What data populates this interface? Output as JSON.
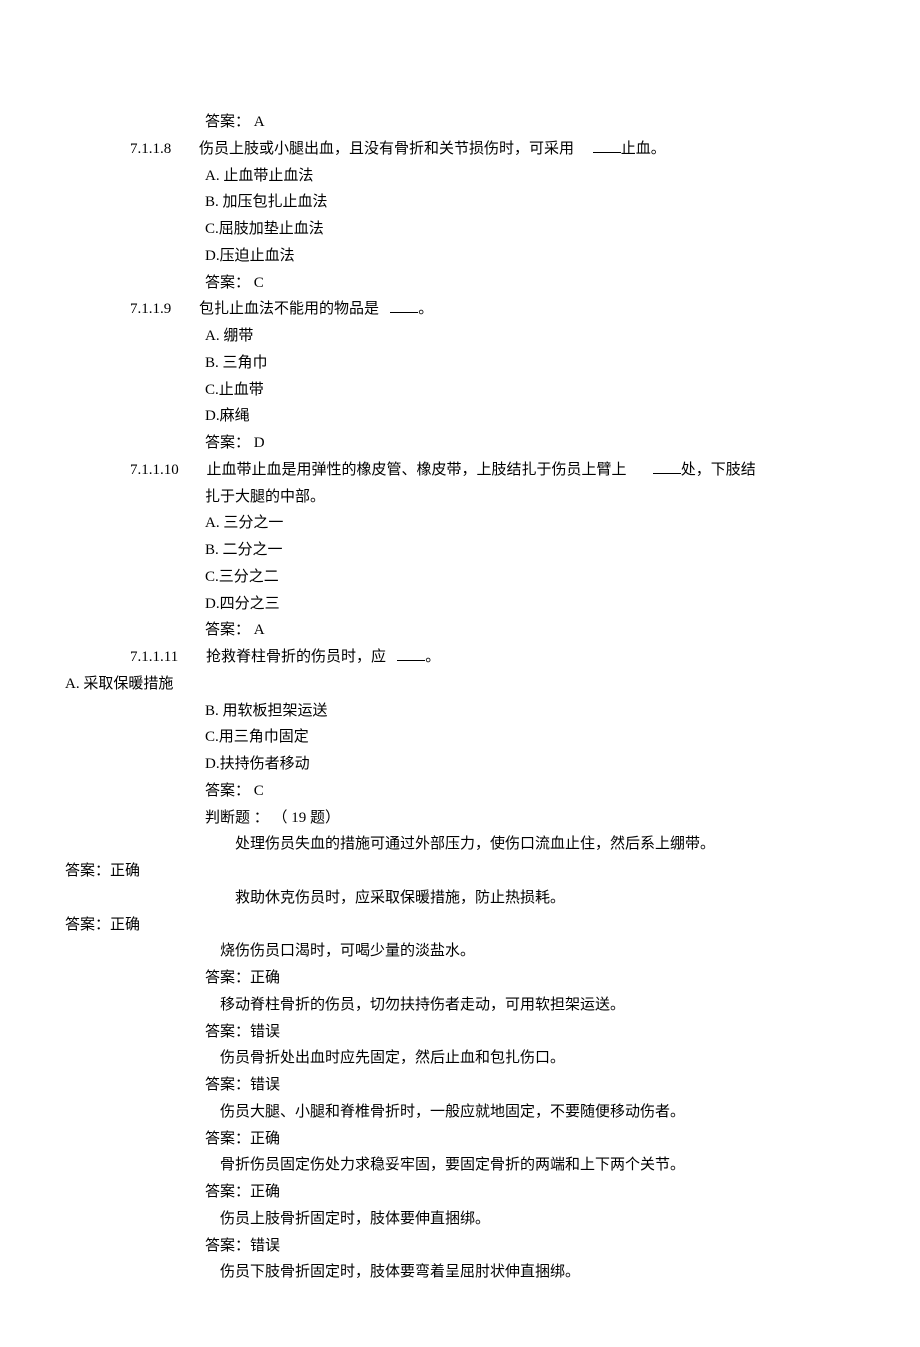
{
  "pre_answer": "答案： A",
  "q8": {
    "num": "7.1.1.8",
    "stem1": "伤员上肢或小腿出血，且没有骨折和关节损伤时，可采用",
    "stem2": "止血。",
    "A": "A. 止血带止血法",
    "B": "B. 加压包扎止血法",
    "C": "C.屈肢加垫止血法",
    "D": "D.压迫止血法",
    "ans": "答案： C"
  },
  "q9": {
    "num": "7.1.1.9",
    "stem1": "包扎止血法不能用的物品是",
    "stem2": "。",
    "A": "A. 绷带",
    "B": "B. 三角巾",
    "C": "C.止血带",
    "D": "D.麻绳",
    "ans": "答案： D"
  },
  "q10": {
    "num": "7.1.1.10",
    "stem1": "止血带止血是用弹性的橡皮管、橡皮带，上肢结扎于伤员上臂上",
    "stem2": "处，下肢结",
    "cont": "扎于大腿的中部。",
    "A": "A. 三分之一",
    "B": "B. 二分之一",
    "C": "C.三分之二",
    "D": "D.四分之三",
    "ans": "答案： A"
  },
  "q11": {
    "num": "7.1.1.11",
    "stem1": "抢救脊柱骨折的伤员时，应",
    "stem2": "。",
    "A": "A.  采取保暖措施",
    "B": "B. 用软板担架运送",
    "C": "C.用三角巾固定",
    "D": "D.扶持伤者移动",
    "ans": "答案： C"
  },
  "tf_header": "判断题 ： （ 19 题）",
  "tf": {
    "t1": {
      "q": "处理伤员失血的措施可通过外部压力，使伤口流血止住，然后系上绷带。",
      "a": "答案：正确"
    },
    "t2": {
      "q": "救助休克伤员时，应采取保暖措施，防止热损耗。",
      "a": "答案：正确"
    },
    "t3": {
      "q": "烧伤伤员口渴时，可喝少量的淡盐水。",
      "a": "答案：正确"
    },
    "t4": {
      "q": "移动脊柱骨折的伤员，切勿扶持伤者走动，可用软担架运送。",
      "a": "答案：错误"
    },
    "t5": {
      "q": "伤员骨折处出血时应先固定，然后止血和包扎伤口。",
      "a": "答案：错误"
    },
    "t6": {
      "q": "伤员大腿、小腿和脊椎骨折时，一般应就地固定，不要随便移动伤者。",
      "a": "答案：正确"
    },
    "t7": {
      "q": "骨折伤员固定伤处力求稳妥牢固，要固定骨折的两端和上下两个关节。",
      "a": "答案：正确"
    },
    "t8": {
      "q": "伤员上肢骨折固定时，肢体要伸直捆绑。",
      "a": "答案：错误"
    },
    "t9": {
      "q": "伤员下肢骨折固定时，肢体要弯着呈屈肘状伸直捆绑。"
    }
  }
}
